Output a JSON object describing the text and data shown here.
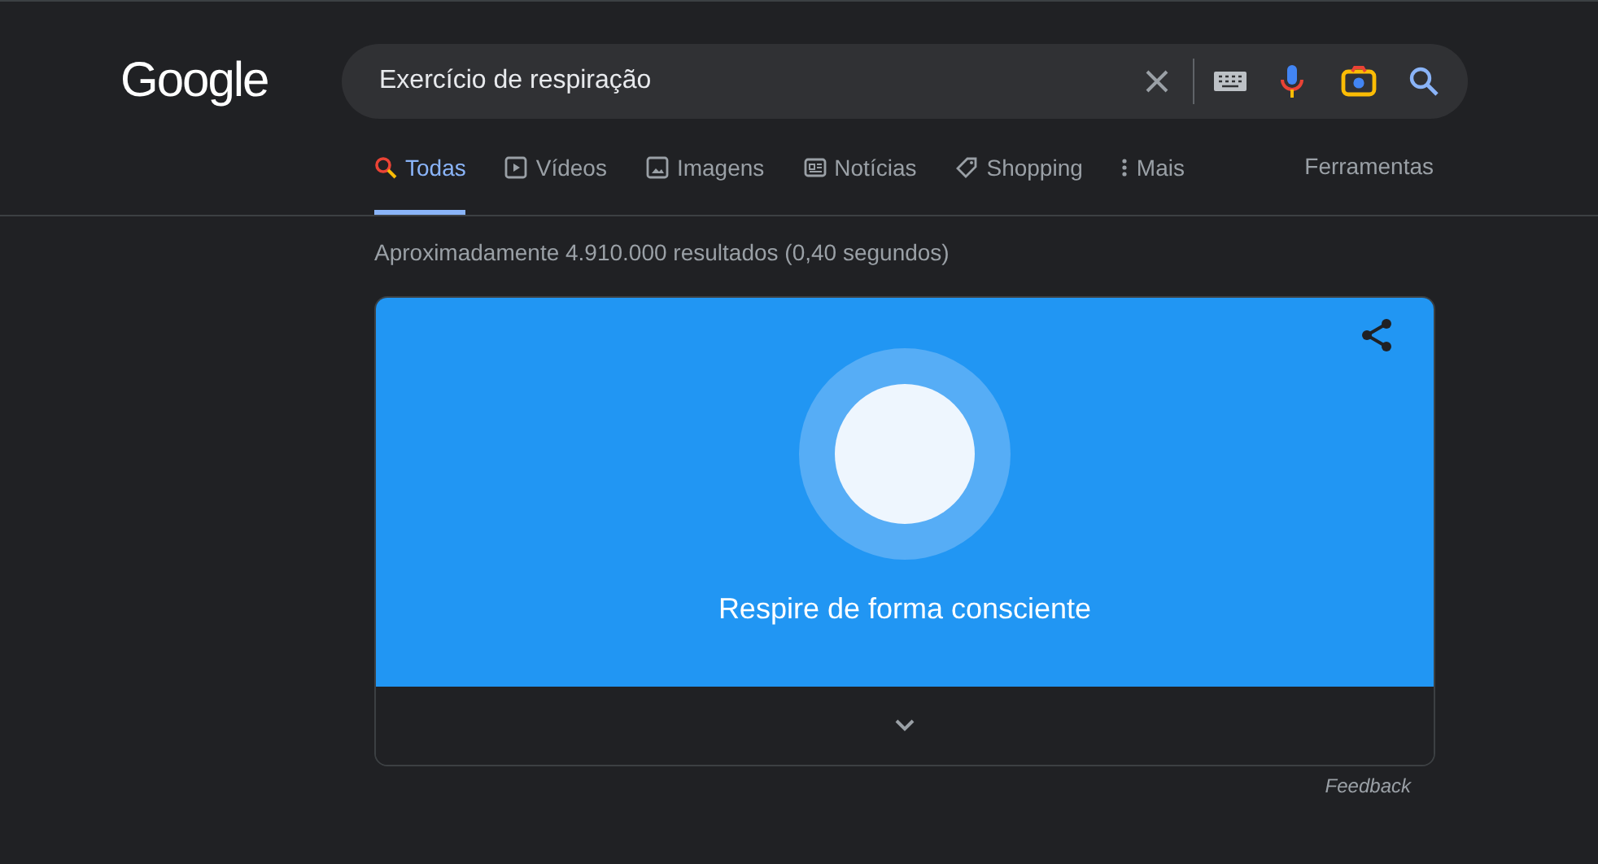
{
  "logo": "Google",
  "search": {
    "value": "Exercício de respiração"
  },
  "tabs": [
    {
      "label": "Todas",
      "kind": "all",
      "selected": true
    },
    {
      "label": "Vídeos",
      "kind": "video",
      "selected": false
    },
    {
      "label": "Imagens",
      "kind": "image",
      "selected": false
    },
    {
      "label": "Notícias",
      "kind": "news",
      "selected": false
    },
    {
      "label": "Shopping",
      "kind": "tag",
      "selected": false
    },
    {
      "label": "Mais",
      "kind": "more",
      "selected": false
    }
  ],
  "tools": "Ferramentas",
  "result_stats": "Aproximadamente 4.910.000 resultados (0,40 segundos)",
  "breathing_card": {
    "caption": "Respire de forma consciente"
  },
  "feedback": "Feedback"
}
